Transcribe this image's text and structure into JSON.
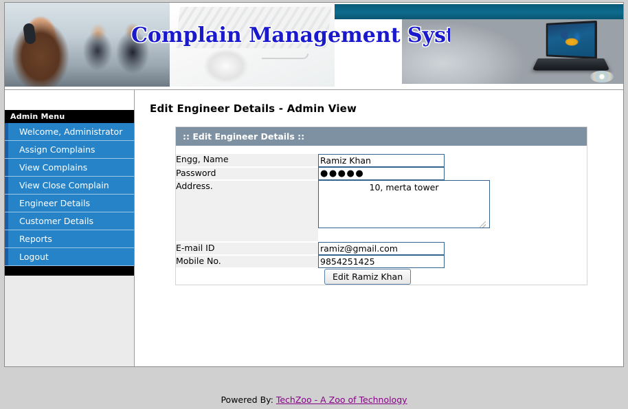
{
  "banner": {
    "title": "Complain Management System",
    "images": [
      "call-center-agents-photo",
      "computer-mouse-keyboard-photo",
      "laptop-with-parrot-wallpaper-photo"
    ]
  },
  "sidebar": {
    "header": "Admin Menu",
    "items": [
      {
        "label": "Welcome, Administrator",
        "name": "welcome-administrator"
      },
      {
        "label": "Assign Complains",
        "name": "assign-complains"
      },
      {
        "label": "View Complains",
        "name": "view-complains"
      },
      {
        "label": "View Close Complain",
        "name": "view-close-complain"
      },
      {
        "label": "Engineer Details",
        "name": "engineer-details"
      },
      {
        "label": "Customer Details",
        "name": "customer-details"
      },
      {
        "label": "Reports",
        "name": "reports"
      },
      {
        "label": "Logout",
        "name": "logout"
      }
    ]
  },
  "main": {
    "page_title": "Edit Engineer Details - Admin View",
    "panel_header": ":: Edit Engineer Details ::",
    "fields": [
      {
        "label": "Engg, Name",
        "value": "Ramiz Khan"
      },
      {
        "label": "Password",
        "value": "●●●●●"
      },
      {
        "label": "Address.",
        "value": "10, merta tower"
      },
      {
        "label": "E-mail ID",
        "value": "ramiz@gmail.com"
      },
      {
        "label": "Mobile No.",
        "value": "9854251425"
      }
    ],
    "submit_label": "Edit Ramiz Khan"
  },
  "footer": {
    "prefix": "Powered By: ",
    "link": "TechZoo - A Zoo of Technology"
  },
  "colors": {
    "menu_blue": "#2683c8",
    "menu_blue_strip": "#1b5ea5",
    "panel_header": "#7e91a2",
    "title_blue": "#1a1acc",
    "link_purple": "#880088",
    "page_bg": "#d0d0d0"
  }
}
